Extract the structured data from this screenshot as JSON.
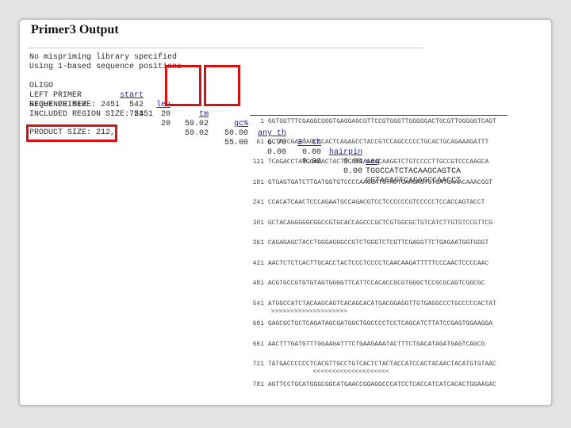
{
  "page": {
    "title": "Primer3 Output"
  },
  "info": {
    "line1": "No mispriming library specified",
    "line2": "Using 1-based sequence positions"
  },
  "table": {
    "headers": [
      "OLIGO",
      "start",
      "len",
      "tm",
      "gc%",
      "any th",
      "3' th",
      "hairpin",
      "seq"
    ],
    "rows": [
      {
        "oligo": "LEFT PRIMER",
        "start": "542",
        "len": "20",
        "tm": "59.02",
        "gc": "50.00",
        "any": "6.70",
        "three": "0.00",
        "hairpin": "0.00",
        "seq": "TGGCCATCTACAAGCAGTCA"
      },
      {
        "oligo": "RIGHT PRIMER",
        "start": "753",
        "len": "20",
        "tm": "59.02",
        "gc": "55.00",
        "any": "0.00",
        "three": "0.00",
        "hairpin": "0.00",
        "seq": "GGTACAGTCAGAGCCAACCT"
      }
    ]
  },
  "summary": {
    "sequence_size": "SEQUENCE SIZE: 2451",
    "included_region": "INCLUDED REGION SIZE: 2451",
    "product_size": "PRODUCT SIZE: 212,"
  },
  "sequence": [
    {
      "num": "1",
      "seq": "GGTGGTTTCGAGGCGGGTGAGGAGCGTTCCGTGGGTTGGGGGACTGCGTTGGGGGTCAGT"
    },
    {
      "num": "61",
      "seq": "GCTATCGAGGAGCCCACTCAGAGCCTACCGTCCAGCCCCCTGCACTGCAGAAAGATTT"
    },
    {
      "num": "121",
      "seq": "TCAGACCTATGGAAACTACTTCCTGAAAACAAGGTCTGTCCCCTTGCCGTCCCAAGCA"
    },
    {
      "num": "181",
      "seq": "GTGAGTGATCTTGATGGTGTCCCCAAGGATGTACTGAAGAGTGTGATGAAACAAACGGT"
    },
    {
      "num": "241",
      "seq": "CCACATCAACTCCCAGAATGCCAGACGTCCTCCCCCCGTCCCCCTCCACCAGTACCT"
    },
    {
      "num": "301",
      "seq": "GCTACAGGGGGCGGCCGTGCACCAGCCCGCTCGTGGCGCTGTCATCTTGTGTCCGTTCG"
    },
    {
      "num": "361",
      "seq": "CAGAGAGCTACCTGGGAGGGCCGTCTGGGTCTCGTTCGAGGTTCTGAGAATGGTGGGT"
    },
    {
      "num": "421",
      "seq": "AACTCTCTCACTTGCACCTACTCCCTCCCCTCAACAAGATTTTTCCCAACTCCCCAAC"
    },
    {
      "num": "481",
      "seq": "ACGTGCCGTGTGTAGTGGGGTTCATTCCACACCGCGTGGGCTCCGCGCAGTCGGCGC"
    },
    {
      "num": "541",
      "seq": "ATGGCCATCTACAAGCAGTCACAGCACATGACGGAGGTTGTGAGGCCCTGCCCCCACTAT"
    },
    {
      "num": "601",
      "seq": "GAGCGCTGCTCAGATAGCGATGGCTGGCCCCTCCTCAGCATCTTATCCGAGTGGAAGGA"
    },
    {
      "num": "661",
      "seq": "AACTTTGATGTTTGGAAGATTTCTGAAGAAATACTTTCTGACATAGATGAGTCAGCG"
    },
    {
      "num": "721",
      "seq": "TATGACCCCCCTCACGTTGCCTGTCACTCTACTACCATCCACTACAACTACATGTGTAAC"
    },
    {
      "num": "781",
      "seq": "AGTTCCTGCATGGGCGGCATGAACCGGAGGCCCATCCTCACCATCATCACACTGGAAGAC"
    }
  ],
  "marks": {
    "left": ">>>>>>>>>>>>>>>>>>>>",
    "right": "<<<<<<<<<<<<<<<<<<<<"
  },
  "colors": {
    "highlight": "#d21414",
    "link": "#2222aa"
  }
}
